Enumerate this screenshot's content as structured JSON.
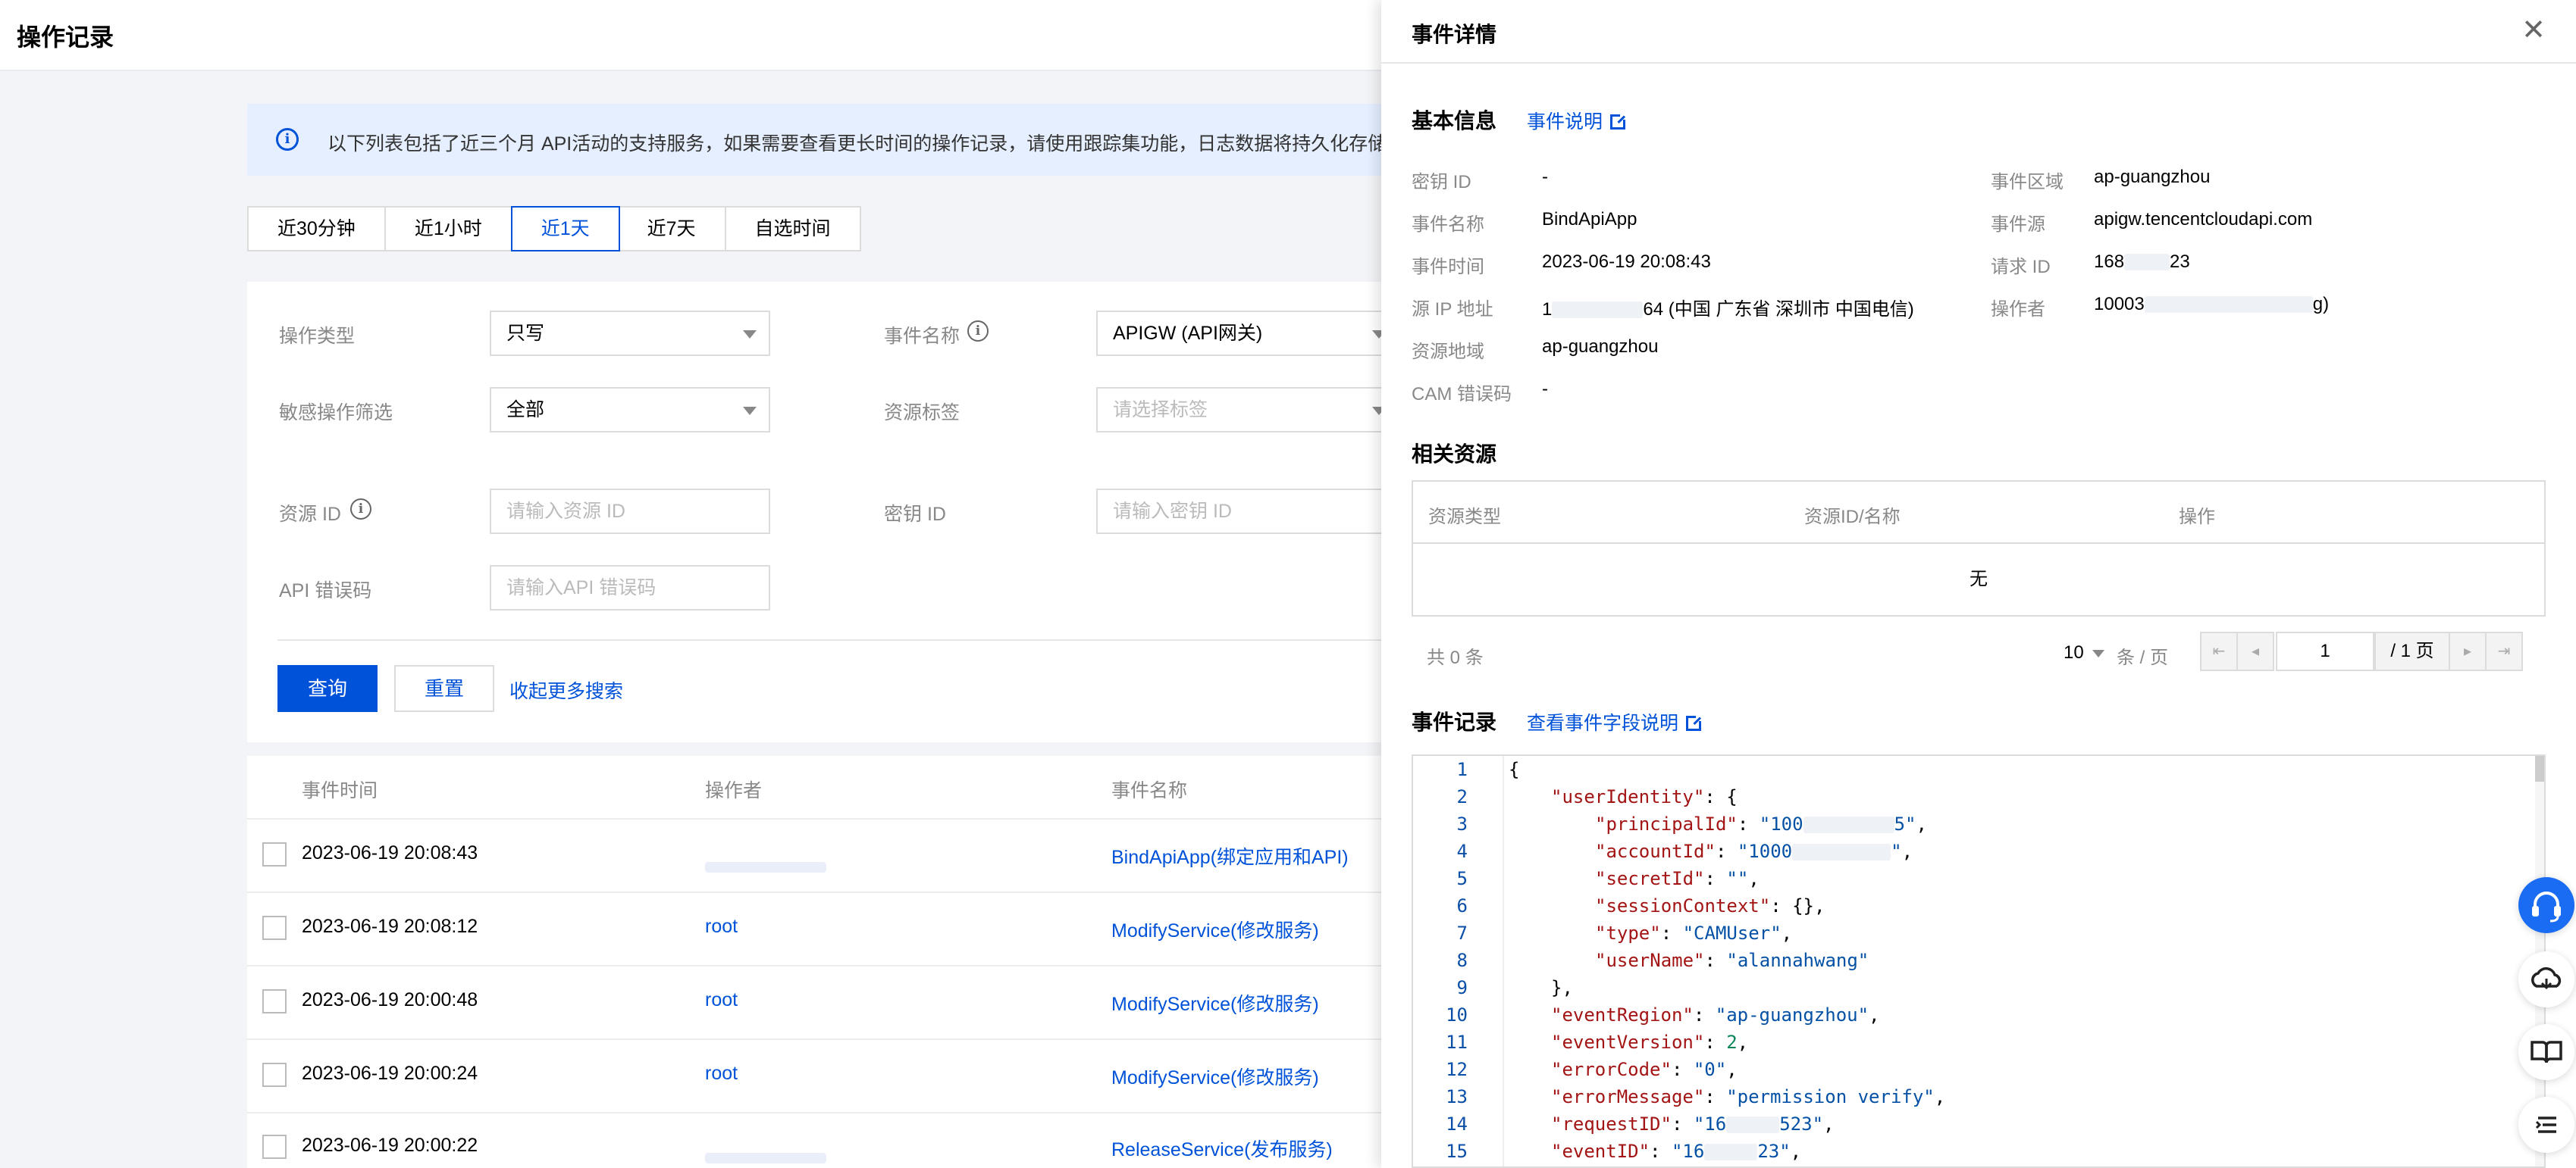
{
  "page": {
    "title": "操作记录",
    "notice": "以下列表包括了近三个月 API活动的支持服务，如果需要查看更长时间的操作记录，请使用跟踪集功能，日志数据将持久化存储到指"
  },
  "time_tabs": [
    {
      "label": "近30分钟",
      "active": false
    },
    {
      "label": "近1小时",
      "active": false
    },
    {
      "label": "近1天",
      "active": true
    },
    {
      "label": "近7天",
      "active": false
    },
    {
      "label": "自选时间",
      "active": false
    }
  ],
  "filters": {
    "op_type_label": "操作类型",
    "op_type_value": "只写",
    "event_name_label": "事件名称",
    "event_name_value": "APIGW (API网关)",
    "sensitive_label": "敏感操作筛选",
    "sensitive_value": "全部",
    "res_tag_label": "资源标签",
    "res_tag_placeholder": "请选择标签",
    "res_id_label": "资源 ID",
    "res_id_placeholder": "请输入资源 ID",
    "secret_id_label": "密钥 ID",
    "secret_id_placeholder": "请输入密钥 ID",
    "api_err_label": "API 错误码",
    "api_err_placeholder": "请输入API 错误码",
    "query_button": "查询",
    "reset_button": "重置",
    "collapse_link": "收起更多搜索"
  },
  "table": {
    "headers": {
      "time": "事件时间",
      "operator": "操作者",
      "event": "事件名称"
    },
    "rows": [
      {
        "time": "2023-06-19 20:08:43",
        "operator": "",
        "event": "BindApiApp(绑定应用和API)"
      },
      {
        "time": "2023-06-19 20:08:12",
        "operator": "root",
        "event": "ModifyService(修改服务)"
      },
      {
        "time": "2023-06-19 20:00:48",
        "operator": "root",
        "event": "ModifyService(修改服务)"
      },
      {
        "time": "2023-06-19 20:00:24",
        "operator": "root",
        "event": "ModifyService(修改服务)"
      },
      {
        "time": "2023-06-19 20:00:22",
        "operator": "",
        "event": "ReleaseService(发布服务)"
      }
    ]
  },
  "drawer": {
    "title": "事件详情",
    "basic_title": "基本信息",
    "basic_link": "事件说明",
    "info_left": [
      {
        "label": "密钥 ID",
        "value": "-"
      },
      {
        "label": "事件名称",
        "value": "BindApiApp"
      },
      {
        "label": "事件时间",
        "value": "2023-06-19 20:08:43"
      },
      {
        "label": "源 IP 地址",
        "value_a": "1",
        "value_b": "64 (中国 广东省 深圳市 中国电信)"
      },
      {
        "label": "资源地域",
        "value": "ap-guangzhou"
      },
      {
        "label": "CAM 错误码",
        "value": "-"
      }
    ],
    "info_right": [
      {
        "label": "事件区域",
        "value": "ap-guangzhou"
      },
      {
        "label": "事件源",
        "value": "apigw.tencentcloudapi.com"
      },
      {
        "label": "请求 ID",
        "value_a": "168",
        "value_b": "23"
      },
      {
        "label": "操作者",
        "value_a": "10003",
        "value_b": "g)"
      }
    ],
    "related_title": "相关资源",
    "related_headers": {
      "type": "资源类型",
      "id": "资源ID/名称",
      "action": "操作"
    },
    "related_empty": "无",
    "pager": {
      "total": "共 0 条",
      "page_size": "10",
      "page_size_unit": "条 / 页",
      "current_page": "1",
      "total_pages": "/ 1 页"
    },
    "record_title": "事件记录",
    "record_link": "查看事件字段说明",
    "code_lines": [
      {
        "n": "1"
      },
      {
        "n": "2"
      },
      {
        "n": "3"
      },
      {
        "n": "4"
      },
      {
        "n": "5"
      },
      {
        "n": "6"
      },
      {
        "n": "7"
      },
      {
        "n": "8"
      },
      {
        "n": "9"
      },
      {
        "n": "10"
      },
      {
        "n": "11"
      },
      {
        "n": "12"
      },
      {
        "n": "13"
      },
      {
        "n": "14"
      },
      {
        "n": "15"
      }
    ],
    "code": {
      "l1": "{",
      "l2_key": "\"userIdentity\"",
      "l2_rest": ": {",
      "l3_key": "\"principalId\"",
      "l3_val_a": "\"100",
      "l3_val_b": "5\"",
      "l4_key": "\"accountId\"",
      "l4_val_a": "\"1000",
      "l4_val_b": "\"",
      "l5_key": "\"secretId\"",
      "l5_val": "\"\"",
      "l6_key": "\"sessionContext\"",
      "l6_rest": ": {},",
      "l7_key": "\"type\"",
      "l7_val": "\"CAMUser\"",
      "l8_key": "\"userName\"",
      "l8_val": "\"alannahwang\"",
      "l9": "},",
      "l10_key": "\"eventRegion\"",
      "l10_val": "\"ap-guangzhou\"",
      "l11_key": "\"eventVersion\"",
      "l11_val": "2",
      "l12_key": "\"errorCode\"",
      "l12_val": "\"0\"",
      "l13_key": "\"errorMessage\"",
      "l13_val": "\"permission verify\"",
      "l14_key": "\"requestID\"",
      "l14_val_a": "\"16",
      "l14_val_b": "523\"",
      "l15_key": "\"eventID\"",
      "l15_val_a": "\"16",
      "l15_val_b": "23\""
    }
  },
  "floating_icons": [
    "headset-icon",
    "cloud-icon",
    "book-icon",
    "list-icon"
  ]
}
